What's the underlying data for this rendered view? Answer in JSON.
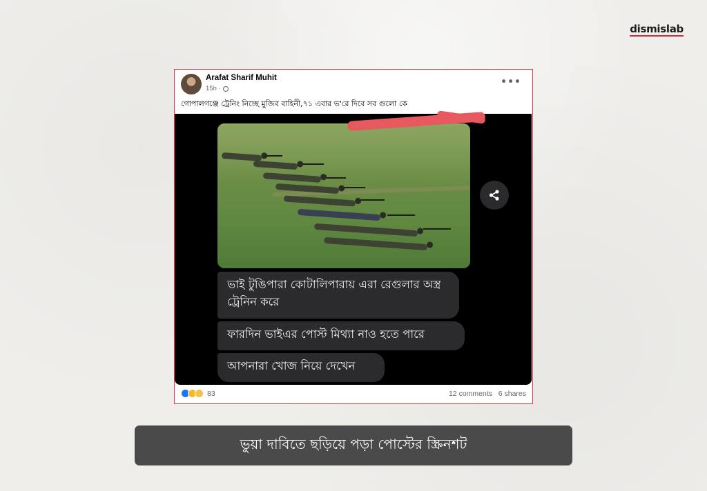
{
  "brand": {
    "logo_text": "dismislab"
  },
  "post": {
    "author": "Arafat Sharif Muhit",
    "time": "15h ·",
    "more_icon": "more-horizontal-icon",
    "caption": "গোপালগঞ্জে ট্রেনিং নিচ্ছে মুজিব বাহিনী,৭১ এবার ভ'রে দিবে সব গুলো কে",
    "media": {
      "share_icon": "share-icon",
      "messages": [
        "ভাই টুঙিপারা কোটালিপারায় এরা রেগুলার অস্ত্র ট্রেনিন করে",
        "ফারদিন ভাইএর পোস্ট মিথ্যা নাও হতে পারে",
        "আপনারা খোজ নিয়ে দেখেন"
      ]
    },
    "footer": {
      "reaction_count": "83",
      "comments": "12 comments",
      "shares": "6 shares"
    }
  },
  "banner": {
    "text": "ভুয়া দাবিতে ছড়িয়ে পড়া পোস্টের স্ক্রিনশট"
  },
  "colors": {
    "frame_accent": "#e23b4f",
    "brand_underline": "#d5283a",
    "redaction": "#e8585f"
  }
}
